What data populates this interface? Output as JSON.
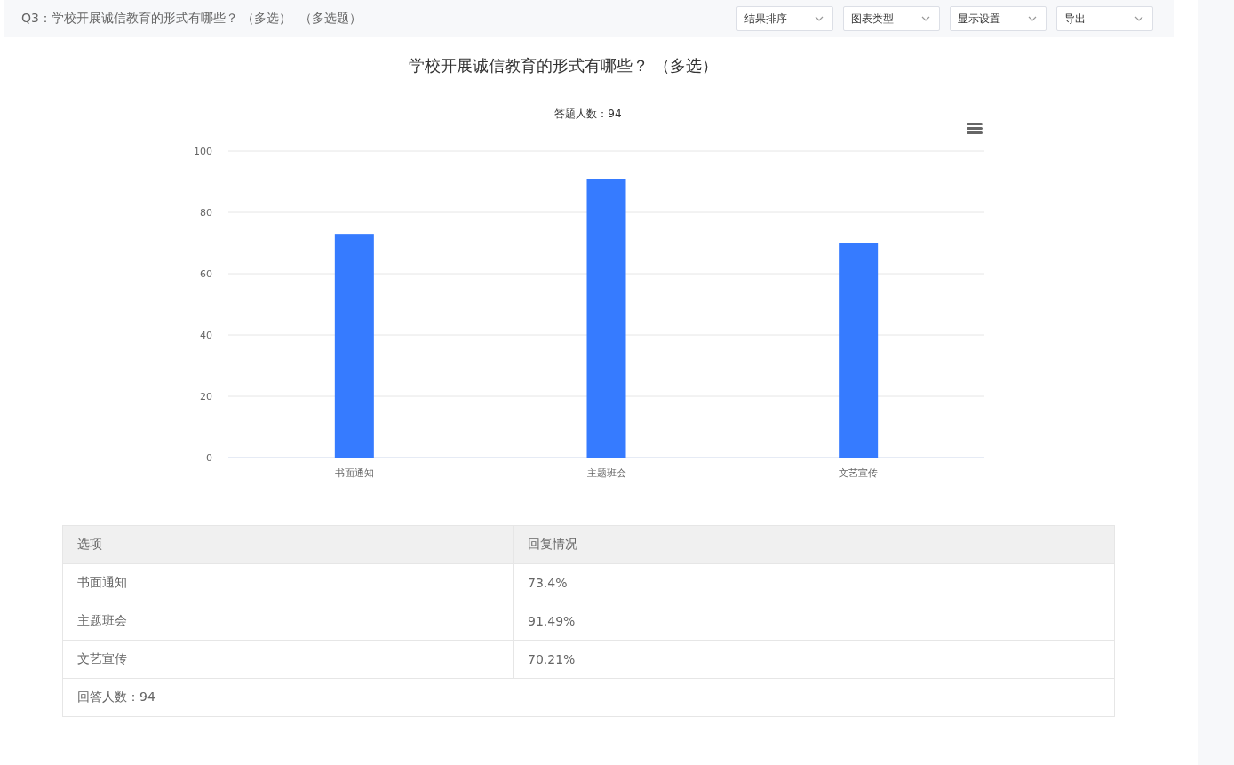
{
  "question": {
    "title": "Q3：学校开展诚信教育的形式有哪些？ （多选）  （多选题）"
  },
  "toolbar": [
    {
      "label": "结果排序"
    },
    {
      "label": "图表类型"
    },
    {
      "label": "显示设置"
    },
    {
      "label": "导出"
    }
  ],
  "chart": {
    "title": "学校开展诚信教育的形式有哪些？ （多选）",
    "subtitle": "答题人数：94",
    "chart_data": {
      "type": "bar",
      "categories": [
        "书面通知",
        "主题班会",
        "文艺宣传"
      ],
      "values": [
        73,
        91,
        70
      ],
      "grid": true,
      "ylim": [
        0,
        100
      ],
      "yticks": [
        0,
        20,
        40,
        60,
        80,
        100
      ]
    }
  },
  "table": {
    "columns": [
      "选项",
      "回复情况"
    ],
    "rows": [
      [
        "书面通知",
        "73.4%"
      ],
      [
        "主题班会",
        "91.49%"
      ],
      [
        "文艺宣传",
        "70.21%"
      ]
    ],
    "footer": "回答人数：94"
  }
}
